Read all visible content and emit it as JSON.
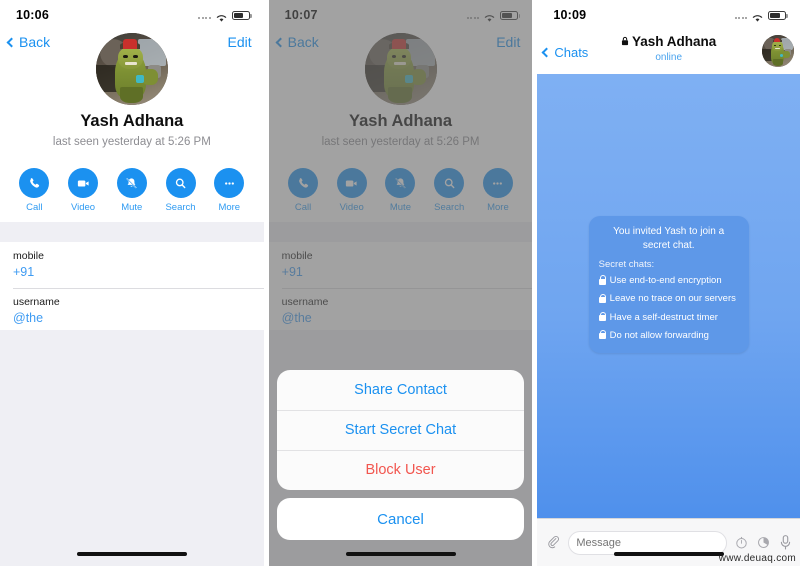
{
  "colors": {
    "accent_blue": "#1b91f0",
    "link_blue": "#3e9bf2",
    "danger_red": "#f2564f",
    "chat_bg_top": "#7fb0f3",
    "chat_bg_bottom": "#4f90ec",
    "bubble_blue": "#5e98e8",
    "list_gray": "#efeff4",
    "dim_overlay": "#696969"
  },
  "panels": [
    {
      "id": "profile",
      "status_bar": {
        "time": "10:06",
        "signal_icon": "signal-dots-icon",
        "wifi_icon": "wifi-icon",
        "battery_icon": "battery-icon"
      },
      "nav": {
        "back_label": "Back",
        "back_icon": "chevron-left-icon",
        "edit_label": "Edit"
      },
      "avatar_name": "hulk-gladiator-avatar",
      "profile": {
        "name": "Yash Adhana",
        "subtitle": "last seen yesterday at 5:26 PM"
      },
      "actions": [
        {
          "label": "Call",
          "icon": "phone-icon"
        },
        {
          "label": "Video",
          "icon": "video-camera-icon"
        },
        {
          "label": "Mute",
          "icon": "bell-slash-icon"
        },
        {
          "label": "Search",
          "icon": "search-icon"
        },
        {
          "label": "More",
          "icon": "ellipsis-icon"
        }
      ],
      "info_rows": [
        {
          "label": "mobile",
          "value": "+91"
        },
        {
          "label": "username",
          "value": "@the"
        }
      ]
    },
    {
      "id": "action-sheet",
      "status_bar": {
        "time": "10:07",
        "signal_icon": "signal-dots-icon",
        "wifi_icon": "wifi-icon",
        "battery_icon": "battery-icon"
      },
      "nav": {
        "back_label": "Back",
        "back_icon": "chevron-left-icon",
        "edit_label": "Edit"
      },
      "avatar_name": "hulk-gladiator-avatar",
      "profile": {
        "name": "Yash Adhana",
        "subtitle": "last seen yesterday at 5:26 PM"
      },
      "actions": [
        {
          "label": "Call",
          "icon": "phone-icon"
        },
        {
          "label": "Video",
          "icon": "video-camera-icon"
        },
        {
          "label": "Mute",
          "icon": "bell-slash-icon"
        },
        {
          "label": "Search",
          "icon": "search-icon"
        },
        {
          "label": "More",
          "icon": "ellipsis-icon"
        }
      ],
      "info_rows": [
        {
          "label": "mobile",
          "value": "+91"
        },
        {
          "label": "username",
          "value": "@the"
        }
      ],
      "action_sheet": {
        "items": [
          {
            "label": "Share Contact",
            "style": "normal"
          },
          {
            "label": "Start Secret Chat",
            "style": "normal"
          },
          {
            "label": "Block User",
            "style": "danger"
          }
        ],
        "cancel_label": "Cancel"
      }
    },
    {
      "id": "secret-chat",
      "status_bar": {
        "time": "10:09",
        "signal_icon": "signal-dots-icon",
        "wifi_icon": "wifi-icon",
        "battery_icon": "battery-icon"
      },
      "nav": {
        "back_label": "Chats",
        "back_icon": "chevron-left-icon",
        "lock_icon": "lock-icon"
      },
      "chat_title": "Yash Adhana",
      "chat_status": "online",
      "avatar_name": "hulk-gladiator-avatar",
      "bubble": {
        "title": "You invited Yash to join a secret chat.",
        "subtitle": "Secret chats:",
        "features": [
          "Use end-to-end encryption",
          "Leave no trace on our servers",
          "Have a self-destruct timer",
          "Do not allow forwarding"
        ]
      },
      "input_bar": {
        "attach_icon": "paperclip-icon",
        "placeholder": "Message",
        "value": "",
        "timer_icon": "stopwatch-icon",
        "self_destruct_icon": "self-destruct-timer-icon",
        "mic_icon": "microphone-icon"
      }
    }
  ],
  "watermark": "www.deuaq.com"
}
